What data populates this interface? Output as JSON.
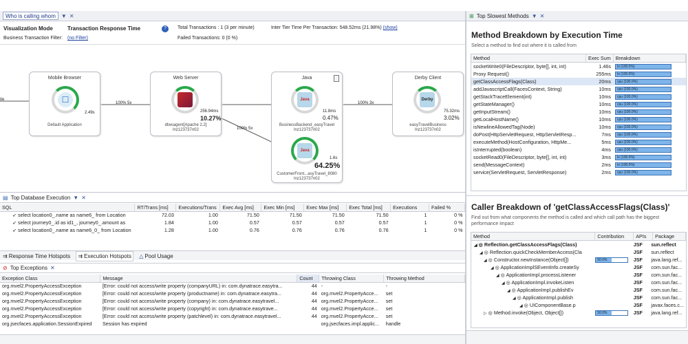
{
  "flow": {
    "tab_title": "Who is calling whom",
    "viz_mode_label": "Visualization Mode",
    "viz_mode_value": "Transaction Response Time",
    "filter_label": "Business Transaction Filter:",
    "filter_value": "(no Filter)",
    "total_tx": "Total Transactions : 1 (3 per minute)",
    "failed_tx": "Failed Transactions: 0 (0 %)",
    "inter_tier": "Inter Tier Time Per Transaction: 548.52ms (21.98%)",
    "show_link": "(show)",
    "left_stub": "ite",
    "nodes": {
      "mobile": {
        "title": "Mobile Browser",
        "time": "2.49s",
        "label": "Default Application"
      },
      "web": {
        "title": "Web Server",
        "time": "256.94ms",
        "pct": "10.27%",
        "label1": "dtwsagent[Apache 2.2]",
        "label2": "lnz123737n02"
      },
      "java": {
        "title": "Java",
        "time": "11.8ms",
        "pct": "0.47%",
        "label1": "BusinessBackend_easyTravel",
        "label2": "lnz123737n02",
        "badge": "Java"
      },
      "java2": {
        "time": "1.6s",
        "pct": "64.25%",
        "label1": "CustomerFront...asyTravel_8080",
        "label2": "lnz123737n02",
        "badge": "Java"
      },
      "derby": {
        "title": "Derby Client",
        "time": "75.32ms",
        "pct": "3.02%",
        "label1": "easyTravelBusiness",
        "label2": "lnz123737n02",
        "badge": "Derby"
      }
    },
    "edges": [
      "100% 5x",
      "100% 3x",
      "100% 5x",
      "100% 5x"
    ]
  },
  "db": {
    "tab_title": "Top Database Execution",
    "columns": [
      "SQL",
      "RT/Trans [ms]",
      "Executions/Trans",
      "Exec Avg [ms]",
      "Exec Min [ms]",
      "Exec Max [ms]",
      "Exec Total [ms]",
      "Executions",
      "Failed %"
    ],
    "rows": [
      [
        "select location0_.name as name6_ from Location",
        "72.03",
        "1.00",
        "71.50",
        "71.50",
        "71.50",
        "71.50",
        "1",
        "0 %"
      ],
      [
        "select journey0_.id as id1_, journey0_.amount as",
        "1.84",
        "1.00",
        "0.57",
        "0.57",
        "0.57",
        "0.57",
        "1",
        "0 %"
      ],
      [
        "select location0_.name as name6_0_ from Location",
        "1.28",
        "1.00",
        "0.76",
        "0.76",
        "0.76",
        "0.76",
        "1",
        "0 %"
      ]
    ],
    "subtabs": [
      "Response Time Hotspots",
      "Execution Hotspots",
      "Pool Usage"
    ]
  },
  "exc": {
    "tab_title": "Top Exceptions",
    "columns": [
      "Exception Class",
      "Message",
      "Count",
      "Throwing Class",
      "Throwing Method"
    ],
    "rows": [
      [
        "org.mvel2.PropertyAccessException",
        "[Error: could not access/write property (companyURL) in: com.dynatrace.easytra...",
        "44",
        "-",
        "-"
      ],
      [
        "org.mvel2.PropertyAccessException",
        "[Error: could not access/write property (productname) in: com.dynatrace.easytra...",
        "44",
        "org.mvel2.PropertyAcce...",
        "set"
      ],
      [
        "org.mvel2.PropertyAccessException",
        "[Error: could not access/write property (company) in: com.dynatrace.easytravel...",
        "44",
        "org.mvel2.PropertyAcce...",
        "set"
      ],
      [
        "org.mvel2.PropertyAccessException",
        "[Error: could not access/write property (copyright) in: com.dynatrace.easytrave...",
        "44",
        "org.mvel2.PropertyAcce...",
        "set"
      ],
      [
        "org.mvel2.PropertyAccessException",
        "[Error: could not access/write property (patchlevel) in: com.dynatrace.easytravel...",
        "44",
        "org.mvel2.PropertyAcce...",
        "set"
      ],
      [
        "org.jsecfaces.application.SessionExpired",
        "Session has expired",
        "",
        "org.jsecfaces.impl.applic...",
        "handle"
      ]
    ]
  },
  "methods": {
    "tab_title": "Top Slowest Methods",
    "heading": "Method Breakdown by Execution Time",
    "subheading": "Select a method to find out where it is called from",
    "columns": [
      "Method",
      "Exec Sum",
      "Breakdown"
    ],
    "rows": [
      [
        "socketWrite0(FileDescriptor, byte[], int, int)",
        "1.46s",
        "io (100.0%)"
      ],
      [
        "Proxy Request()",
        "255ms",
        "io (100.0%)"
      ],
      [
        "getClassAccessFlags(Class)",
        "20ms",
        "cpu (100.0%)"
      ],
      [
        "addJavascriptCall(FacesContext, String)",
        "10ms",
        "cpu (100.0%)"
      ],
      [
        "getStackTraceElement(int)",
        "10ms",
        "cpu (100.0%)"
      ],
      [
        "getStateManager()",
        "10ms",
        "cpu (100.0%)"
      ],
      [
        "getInputStream()",
        "10ms",
        "cpu (100.0%)"
      ],
      [
        "getLocalHostName()",
        "10ms",
        "cpu (100.0%)"
      ],
      [
        "isNewlineAllowedTag(Node)",
        "10ms",
        "cpu (100.0%)"
      ],
      [
        "doPost(HttpServletRequest, HttpServletResp...",
        "7ms",
        "cpu (100.0%)"
      ],
      [
        "executeMethod(HostConfiguration, HttpMe...",
        "5ms",
        "cpu (100.0%)"
      ],
      [
        "isInterrupted(boolean)",
        "4ms",
        "cpu (100.0%)"
      ],
      [
        "socketRead0(FileDescriptor, byte[], int, int)",
        "3ms",
        "io (100.0%)"
      ],
      [
        "send(MessageContext)",
        "2ms",
        "io (100.0%)"
      ],
      [
        "service(ServletRequest, ServletResponse)",
        "2ms",
        "cpu (100.0%)"
      ]
    ]
  },
  "caller": {
    "heading": "Caller Breakdown of 'getClassAccessFlags(Class)'",
    "subheading": "Find out from what components the method is called and which call path has the biggest performance impact",
    "columns": [
      "Method",
      "Contribution",
      "APIs",
      "Package"
    ],
    "rows": [
      [
        "Reflection.getClassAccessFlags(Class)",
        "",
        "JSF",
        "sun.reflect"
      ],
      [
        "Reflection.quickCheckMemberAccess(Cla",
        "",
        "JSF",
        "sun.reflect"
      ],
      [
        "Constructor.newInstance(Object[])",
        "50.0%",
        "JSF",
        "java.lang.ref..."
      ],
      [
        "ApplicationImplSEventInfo.createSy",
        "",
        "JSF",
        "com.sun.fac..."
      ],
      [
        "ApplicationImpl.processListener",
        "",
        "JSF",
        "com.sun.fac..."
      ],
      [
        "ApplicationImpl.invokeListen",
        "",
        "JSF",
        "com.sun.fac..."
      ],
      [
        "ApplicationImpl.publishEv",
        "",
        "JSF",
        "com.sun.fac..."
      ],
      [
        "ApplicationImpl.publish",
        "",
        "JSF",
        "com.sun.fac..."
      ],
      [
        "UIComponentBase.p",
        "",
        "JSF",
        "javax.faces.c..."
      ],
      [
        "Method.invoke(Object, Object[])",
        "50.0%",
        "JSF",
        "java.lang.ref..."
      ]
    ]
  }
}
